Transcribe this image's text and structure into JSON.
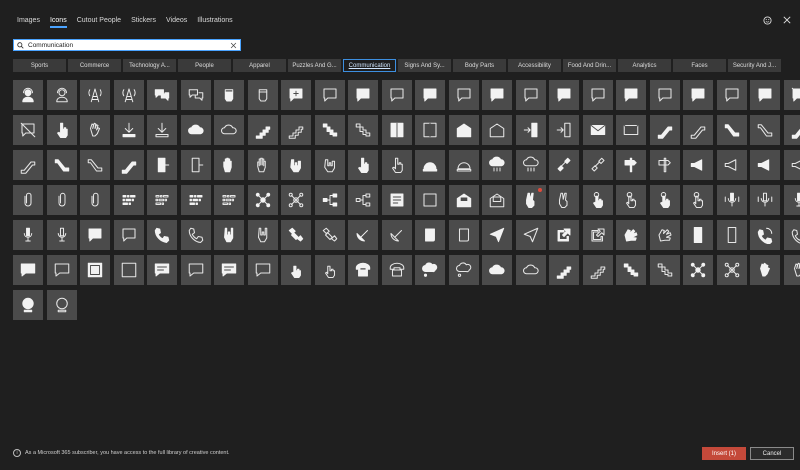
{
  "tabs": [
    {
      "label": "Images"
    },
    {
      "label": "Icons"
    },
    {
      "label": "Cutout People"
    },
    {
      "label": "Stickers"
    },
    {
      "label": "Videos"
    },
    {
      "label": "Illustrations"
    }
  ],
  "active_tab": "Icons",
  "search": {
    "value": "Communication"
  },
  "categories": [
    {
      "label": "Sports"
    },
    {
      "label": "Commerce"
    },
    {
      "label": "Technology A..."
    },
    {
      "label": "People"
    },
    {
      "label": "Apparel"
    },
    {
      "label": "Puzzles And G..."
    },
    {
      "label": "Communication"
    },
    {
      "label": "Signs And Sy..."
    },
    {
      "label": "Body Parts"
    },
    {
      "label": "Accessibility"
    },
    {
      "label": "Food And Drin..."
    },
    {
      "label": "Analytics"
    },
    {
      "label": "Faces"
    },
    {
      "label": "Security And J..."
    }
  ],
  "active_category": "Communication",
  "icons": [
    {
      "name": "support-agent",
      "style": "solid"
    },
    {
      "name": "support-agent",
      "style": "outline"
    },
    {
      "name": "radio-tower",
      "style": "solid"
    },
    {
      "name": "radio-tower",
      "style": "outline"
    },
    {
      "name": "chat-bubbles",
      "style": "solid"
    },
    {
      "name": "chat-bubbles",
      "style": "outline"
    },
    {
      "name": "fist",
      "style": "solid"
    },
    {
      "name": "fist",
      "style": "outline"
    },
    {
      "name": "chat-add",
      "style": "solid"
    },
    {
      "name": "chat-add",
      "style": "outline"
    },
    {
      "name": "chat-heart",
      "style": "solid"
    },
    {
      "name": "chat-heart",
      "style": "outline"
    },
    {
      "name": "chat-lightning",
      "style": "solid"
    },
    {
      "name": "chat-lightning",
      "style": "outline"
    },
    {
      "name": "chat-heart",
      "style": "solid"
    },
    {
      "name": "chat-heart",
      "style": "outline"
    },
    {
      "name": "chat-heart",
      "style": "solid"
    },
    {
      "name": "chat-heart",
      "style": "outline"
    },
    {
      "name": "chat-shield",
      "style": "solid"
    },
    {
      "name": "chat-shield",
      "style": "outline"
    },
    {
      "name": "chat-alert",
      "style": "solid"
    },
    {
      "name": "chat-alert",
      "style": "outline"
    },
    {
      "name": "chat-thumbs-up",
      "style": "solid"
    },
    {
      "name": "no-chat",
      "style": "solid"
    },
    {
      "name": "no-chat",
      "style": "outline"
    },
    {
      "name": "hand-pointer",
      "style": "solid"
    },
    {
      "name": "hand-wave",
      "style": "outline"
    },
    {
      "name": "download",
      "style": "solid"
    },
    {
      "name": "download",
      "style": "outline"
    },
    {
      "name": "cloud-download",
      "style": "solid"
    },
    {
      "name": "cloud-download",
      "style": "outline"
    },
    {
      "name": "stairs",
      "style": "solid"
    },
    {
      "name": "stairs",
      "style": "outline"
    },
    {
      "name": "stairs-down",
      "style": "solid"
    },
    {
      "name": "stairs-down",
      "style": "outline"
    },
    {
      "name": "elevator",
      "style": "solid"
    },
    {
      "name": "elevator",
      "style": "outline"
    },
    {
      "name": "mail-open",
      "style": "solid"
    },
    {
      "name": "mail-open",
      "style": "outline"
    },
    {
      "name": "door-enter",
      "style": "solid"
    },
    {
      "name": "door-enter",
      "style": "outline"
    },
    {
      "name": "mail",
      "style": "solid"
    },
    {
      "name": "mail",
      "style": "outline"
    },
    {
      "name": "escalator",
      "style": "solid"
    },
    {
      "name": "escalator",
      "style": "outline"
    },
    {
      "name": "escalator-down",
      "style": "solid"
    },
    {
      "name": "escalator-down",
      "style": "outline"
    },
    {
      "name": "escalator",
      "style": "solid"
    },
    {
      "name": "escalator",
      "style": "outline"
    },
    {
      "name": "escalator-down",
      "style": "solid"
    },
    {
      "name": "escalator-down",
      "style": "outline"
    },
    {
      "name": "escalator",
      "style": "solid"
    },
    {
      "name": "exit-door",
      "style": "solid"
    },
    {
      "name": "exit-door",
      "style": "outline"
    },
    {
      "name": "hand-palm",
      "style": "solid"
    },
    {
      "name": "hand-palm",
      "style": "outline"
    },
    {
      "name": "hand-call",
      "style": "solid"
    },
    {
      "name": "hand-call",
      "style": "outline"
    },
    {
      "name": "hand-pointer",
      "style": "solid"
    },
    {
      "name": "hand-pointer",
      "style": "outline"
    },
    {
      "name": "service-bell",
      "style": "solid"
    },
    {
      "name": "service-bell",
      "style": "outline"
    },
    {
      "name": "cloud-rain",
      "style": "solid"
    },
    {
      "name": "cloud-rain",
      "style": "outline"
    },
    {
      "name": "link",
      "style": "solid"
    },
    {
      "name": "link",
      "style": "outline"
    },
    {
      "name": "direction-sign",
      "style": "solid"
    },
    {
      "name": "direction-sign",
      "style": "outline"
    },
    {
      "name": "megaphone",
      "style": "solid"
    },
    {
      "name": "megaphone",
      "style": "outline"
    },
    {
      "name": "megaphone",
      "style": "solid"
    },
    {
      "name": "megaphone",
      "style": "outline"
    },
    {
      "name": "paperclip",
      "style": "outline"
    },
    {
      "name": "paperclip",
      "style": "solid"
    },
    {
      "name": "paperclip",
      "style": "outline"
    },
    {
      "name": "morse-code",
      "style": "solid"
    },
    {
      "name": "morse-code",
      "style": "outline"
    },
    {
      "name": "morse-code",
      "style": "solid"
    },
    {
      "name": "morse-code",
      "style": "outline"
    },
    {
      "name": "network",
      "style": "solid"
    },
    {
      "name": "network",
      "style": "outline"
    },
    {
      "name": "org-chart",
      "style": "solid"
    },
    {
      "name": "org-chart",
      "style": "outline"
    },
    {
      "name": "newspaper",
      "style": "solid"
    },
    {
      "name": "newspaper",
      "style": "outline"
    },
    {
      "name": "mail-letter",
      "style": "solid"
    },
    {
      "name": "mail-letter",
      "style": "outline"
    },
    {
      "name": "peace-hand",
      "style": "solid",
      "dot": true
    },
    {
      "name": "peace-hand",
      "style": "outline"
    },
    {
      "name": "touch-hand",
      "style": "solid"
    },
    {
      "name": "touch-hand",
      "style": "outline"
    },
    {
      "name": "touch-hand",
      "style": "solid"
    },
    {
      "name": "touch-hand",
      "style": "outline"
    },
    {
      "name": "microphone-waves",
      "style": "solid"
    },
    {
      "name": "microphone-waves",
      "style": "outline"
    },
    {
      "name": "microphone",
      "style": "solid"
    },
    {
      "name": "microphone",
      "style": "solid"
    },
    {
      "name": "microphone",
      "style": "outline"
    },
    {
      "name": "chat-star",
      "style": "solid"
    },
    {
      "name": "chat-star",
      "style": "outline"
    },
    {
      "name": "phone",
      "style": "solid"
    },
    {
      "name": "phone",
      "style": "outline"
    },
    {
      "name": "rock-hand",
      "style": "solid"
    },
    {
      "name": "rock-hand",
      "style": "outline"
    },
    {
      "name": "satellite",
      "style": "solid"
    },
    {
      "name": "satellite",
      "style": "outline"
    },
    {
      "name": "satellite-dish",
      "style": "solid"
    },
    {
      "name": "satellite-dish",
      "style": "outline"
    },
    {
      "name": "scroll",
      "style": "solid"
    },
    {
      "name": "scroll",
      "style": "outline"
    },
    {
      "name": "paper-plane",
      "style": "solid"
    },
    {
      "name": "paper-plane",
      "style": "outline"
    },
    {
      "name": "share-arrow",
      "style": "solid"
    },
    {
      "name": "share-arrow",
      "style": "outline"
    },
    {
      "name": "sign-language",
      "style": "solid"
    },
    {
      "name": "sign-language",
      "style": "outline"
    },
    {
      "name": "smartphone",
      "style": "solid"
    },
    {
      "name": "smartphone",
      "style": "outline"
    },
    {
      "name": "phone-ringing",
      "style": "solid"
    },
    {
      "name": "phone-ringing",
      "style": "outline"
    },
    {
      "name": "speech-bubble",
      "style": "solid"
    },
    {
      "name": "speech-bubble",
      "style": "outline"
    },
    {
      "name": "stamp-frame",
      "style": "solid"
    },
    {
      "name": "stamp-frame",
      "style": "outline"
    },
    {
      "name": "chat-lines",
      "style": "solid"
    },
    {
      "name": "chat-lines",
      "style": "outline"
    },
    {
      "name": "chat-lines",
      "style": "solid"
    },
    {
      "name": "chat-lines",
      "style": "outline"
    },
    {
      "name": "touch-gesture",
      "style": "solid"
    },
    {
      "name": "touch-gesture",
      "style": "outline"
    },
    {
      "name": "telephone",
      "style": "solid"
    },
    {
      "name": "telephone",
      "style": "outline"
    },
    {
      "name": "thought-bubble",
      "style": "solid"
    },
    {
      "name": "thought-bubble",
      "style": "outline"
    },
    {
      "name": "cloud-upload",
      "style": "solid"
    },
    {
      "name": "cloud-upload",
      "style": "outline"
    },
    {
      "name": "stairs",
      "style": "solid"
    },
    {
      "name": "stairs",
      "style": "outline"
    },
    {
      "name": "stairs-down",
      "style": "solid"
    },
    {
      "name": "stairs-down",
      "style": "outline"
    },
    {
      "name": "network",
      "style": "solid"
    },
    {
      "name": "network",
      "style": "outline"
    },
    {
      "name": "hand-wave",
      "style": "solid"
    },
    {
      "name": "hand-wave",
      "style": "outline"
    },
    {
      "name": "webcam",
      "style": "solid"
    },
    {
      "name": "webcam",
      "style": "outline"
    }
  ],
  "footer": {
    "info_text": "As a Microsoft 365 subscriber, you have access to the full library of creative content."
  },
  "buttons": {
    "insert": "Insert (1)",
    "cancel": "Cancel"
  },
  "colors": {
    "tile": "#4b4b4b",
    "accent": "#4aa3ff",
    "insert": "#c4493a",
    "background": "#1f1f1f"
  }
}
